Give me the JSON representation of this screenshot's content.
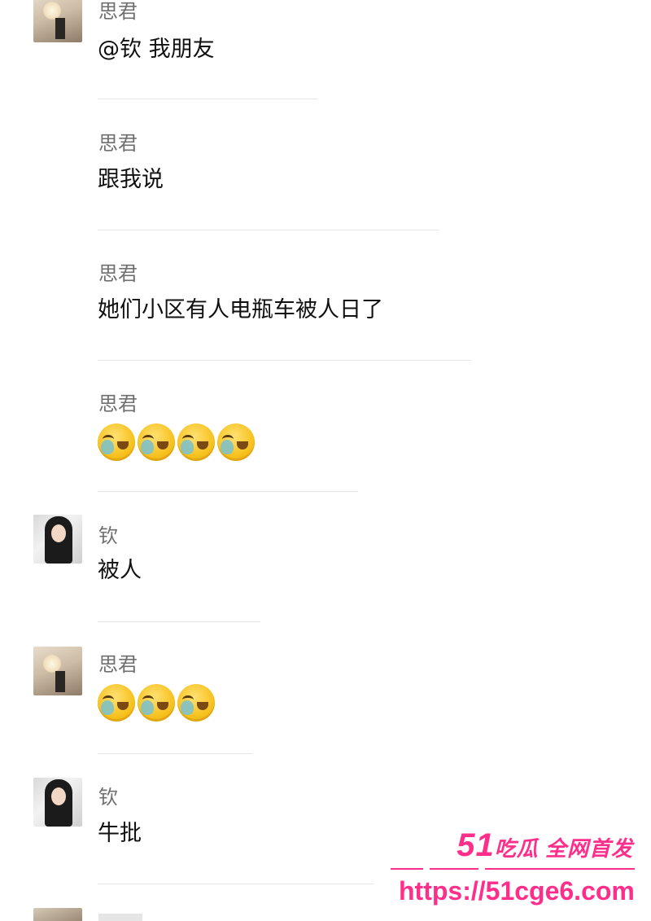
{
  "messages": [
    {
      "name": "思君",
      "text": "@钦 我朋友",
      "avatar": "lamp-room-avatar"
    },
    {
      "name": "思君",
      "text": "跟我说"
    },
    {
      "name": "思君",
      "text": "她们小区有人电瓶车被人日了"
    },
    {
      "name": "思君",
      "emojis": [
        "laugh-cry-emoji",
        "laugh-cry-emoji",
        "laugh-cry-emoji",
        "laugh-cry-emoji"
      ]
    },
    {
      "name": "钦",
      "text": "被人",
      "avatar": "woman-portrait-avatar"
    },
    {
      "name": "思君",
      "emojis": [
        "laugh-cry-emoji",
        "laugh-cry-emoji",
        "laugh-cry-emoji"
      ],
      "avatar": "lamp-room-avatar"
    },
    {
      "name": "钦",
      "text": "牛批",
      "avatar": "woman-portrait-avatar"
    }
  ],
  "watermark": {
    "brand_num": "51",
    "brand_rest": "吃瓜 全网首发",
    "url": "https://51cge6.com",
    "color": "#ff2e8a"
  }
}
